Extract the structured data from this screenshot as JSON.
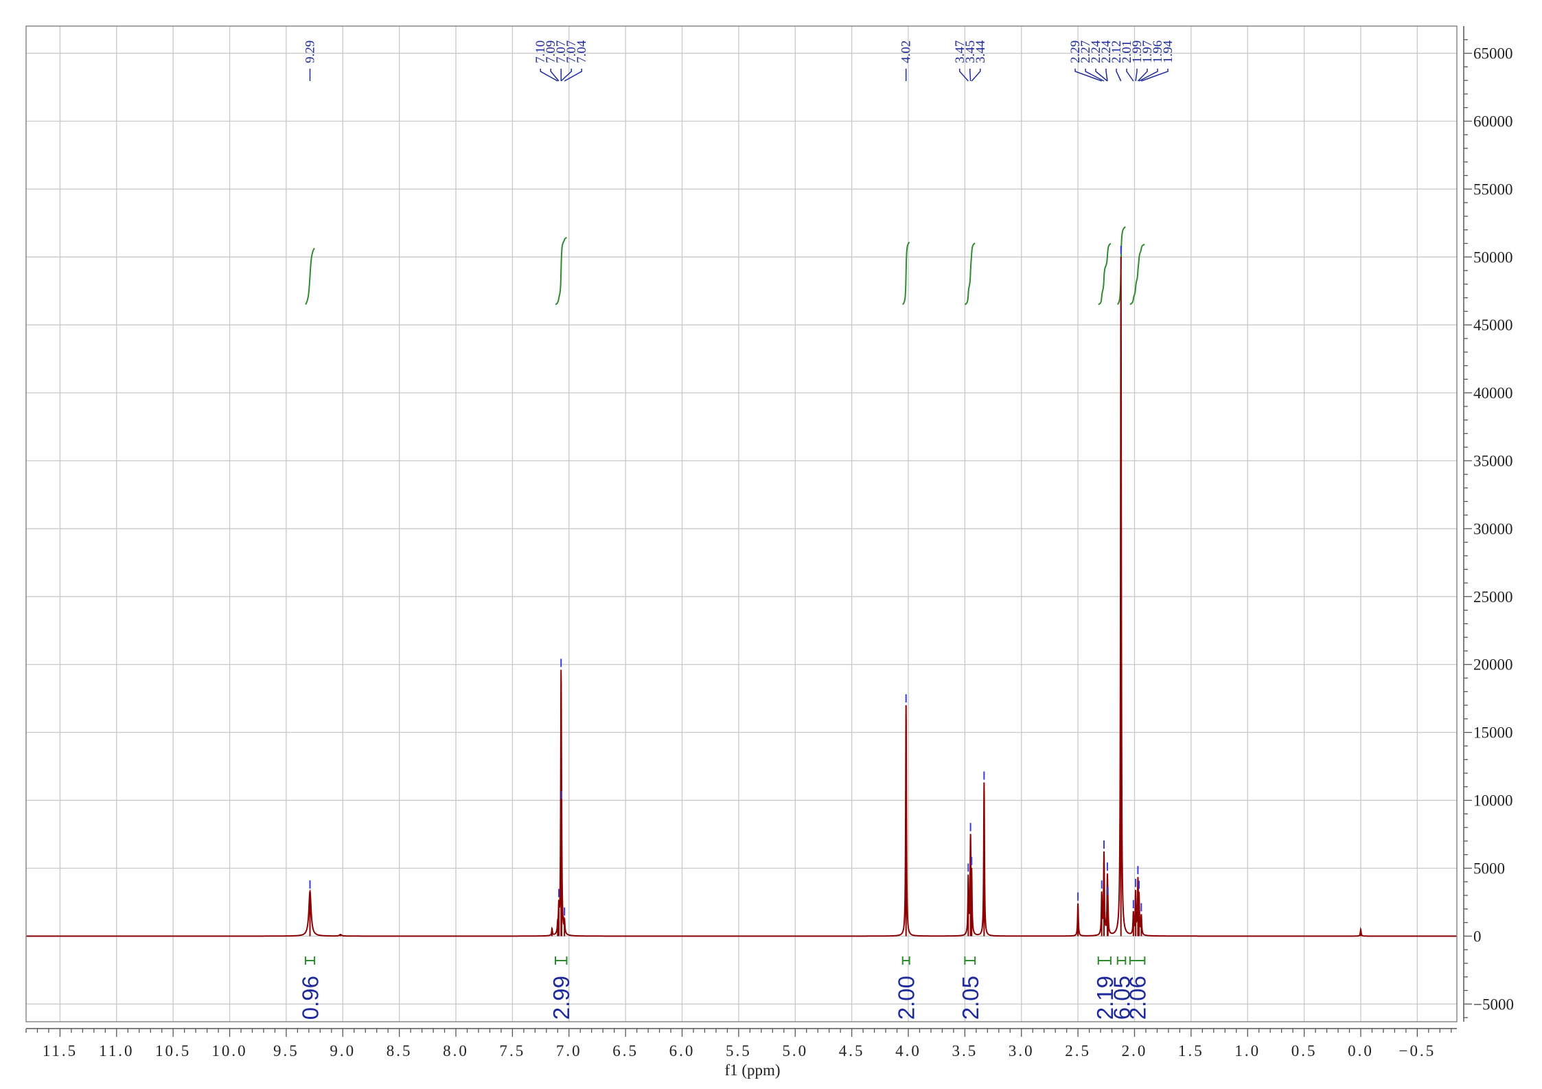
{
  "chart_data": {
    "type": "line",
    "xlabel": "f1 (ppm)",
    "ylabel": "",
    "xlim": [
      11.8,
      -0.85
    ],
    "ylim": [
      -6300,
      67000
    ],
    "x_reversed": true,
    "grid": true,
    "x_ticks": [
      "11.5",
      "11.0",
      "10.5",
      "10.0",
      "9.5",
      "9.0",
      "8.5",
      "8.0",
      "7.5",
      "7.0",
      "6.5",
      "6.0",
      "5.5",
      "5.0",
      "4.5",
      "4.0",
      "3.5",
      "3.0",
      "2.5",
      "2.0",
      "1.5",
      "1.0",
      "0.5",
      "0.0",
      "−0.5"
    ],
    "x_tick_values": [
      11.5,
      11.0,
      10.5,
      10.0,
      9.5,
      9.0,
      8.5,
      8.0,
      7.5,
      7.0,
      6.5,
      6.0,
      5.5,
      5.0,
      4.5,
      4.0,
      3.5,
      3.0,
      2.5,
      2.0,
      1.5,
      1.0,
      0.5,
      0.0,
      -0.5
    ],
    "y_ticks": [
      "65000",
      "60000",
      "55000",
      "50000",
      "45000",
      "40000",
      "35000",
      "30000",
      "25000",
      "20000",
      "15000",
      "10000",
      "5000",
      "0",
      "−5000"
    ],
    "y_tick_values": [
      65000,
      60000,
      55000,
      50000,
      45000,
      40000,
      35000,
      30000,
      25000,
      20000,
      15000,
      10000,
      5000,
      0,
      -5000
    ],
    "series": [
      {
        "color": "#8b0000",
        "peaks": [
          {
            "x": 9.29,
            "y": 3300,
            "w": 0.012
          },
          {
            "x": 9.02,
            "y": 120,
            "w": 0.01
          },
          {
            "x": 7.15,
            "y": 500,
            "w": 0.004
          },
          {
            "x": 7.1,
            "y": 600,
            "w": 0.004
          },
          {
            "x": 7.09,
            "y": 1800,
            "w": 0.004
          },
          {
            "x": 7.07,
            "y": 18500,
            "w": 0.004
          },
          {
            "x": 7.065,
            "y": 2600,
            "w": 0.004
          },
          {
            "x": 7.04,
            "y": 900,
            "w": 0.004
          },
          {
            "x": 4.02,
            "y": 17000,
            "w": 0.004
          },
          {
            "x": 3.47,
            "y": 4200,
            "w": 0.004
          },
          {
            "x": 3.45,
            "y": 6800,
            "w": 0.004
          },
          {
            "x": 3.44,
            "y": 4000,
            "w": 0.004
          },
          {
            "x": 3.33,
            "y": 11300,
            "w": 0.004
          },
          {
            "x": 2.5,
            "y": 2400,
            "w": 0.004
          },
          {
            "x": 2.29,
            "y": 3000,
            "w": 0.004
          },
          {
            "x": 2.27,
            "y": 6000,
            "w": 0.004
          },
          {
            "x": 2.24,
            "y": 4000,
            "w": 0.004
          },
          {
            "x": 2.235,
            "y": 1100,
            "w": 0.004
          },
          {
            "x": 2.12,
            "y": 50000,
            "w": 0.004
          },
          {
            "x": 2.01,
            "y": 1600,
            "w": 0.004
          },
          {
            "x": 1.99,
            "y": 3100,
            "w": 0.004
          },
          {
            "x": 1.97,
            "y": 3800,
            "w": 0.004
          },
          {
            "x": 1.96,
            "y": 2600,
            "w": 0.004
          },
          {
            "x": 1.94,
            "y": 1400,
            "w": 0.004
          },
          {
            "x": 0.0,
            "y": 500,
            "w": 0.004
          }
        ]
      }
    ],
    "peak_labels": [
      {
        "text": "9.29",
        "x": 9.29
      },
      {
        "text": "7.10",
        "x": 7.1
      },
      {
        "text": "7.09",
        "x": 7.09
      },
      {
        "text": "7.07",
        "x": 7.07
      },
      {
        "text": "7.07",
        "x": 7.07
      },
      {
        "text": "7.04",
        "x": 7.04
      },
      {
        "text": "4.02",
        "x": 4.02
      },
      {
        "text": "3.47",
        "x": 3.47
      },
      {
        "text": "3.45",
        "x": 3.45
      },
      {
        "text": "3.44",
        "x": 3.44
      },
      {
        "text": "2.29",
        "x": 2.29
      },
      {
        "text": "2.27",
        "x": 2.27
      },
      {
        "text": "2.24",
        "x": 2.24
      },
      {
        "text": "2.24",
        "x": 2.24
      },
      {
        "text": "2.12",
        "x": 2.12
      },
      {
        "text": "2.01",
        "x": 2.01
      },
      {
        "text": "1.99",
        "x": 1.99
      },
      {
        "text": "1.97",
        "x": 1.97
      },
      {
        "text": "1.96",
        "x": 1.96
      },
      {
        "text": "1.94",
        "x": 1.94
      }
    ],
    "integrals": [
      {
        "label": "0.96",
        "from": 9.33,
        "to": 9.25
      },
      {
        "label": "2.99",
        "from": 7.12,
        "to": 7.02
      },
      {
        "label": "2.00",
        "from": 4.05,
        "to": 3.99
      },
      {
        "label": "2.05",
        "from": 3.5,
        "to": 3.41
      },
      {
        "label": "2.19",
        "from": 2.32,
        "to": 2.21
      },
      {
        "label": "6.05",
        "from": 2.15,
        "to": 2.08
      },
      {
        "label": "2.06",
        "from": 2.04,
        "to": 1.91
      }
    ],
    "colors": {
      "spectrum": "#8b0000",
      "integral_curve": "#2e8b2e",
      "labels": "#1e2a9c",
      "grid": "#c8c8c8",
      "axis": "#555555"
    }
  }
}
